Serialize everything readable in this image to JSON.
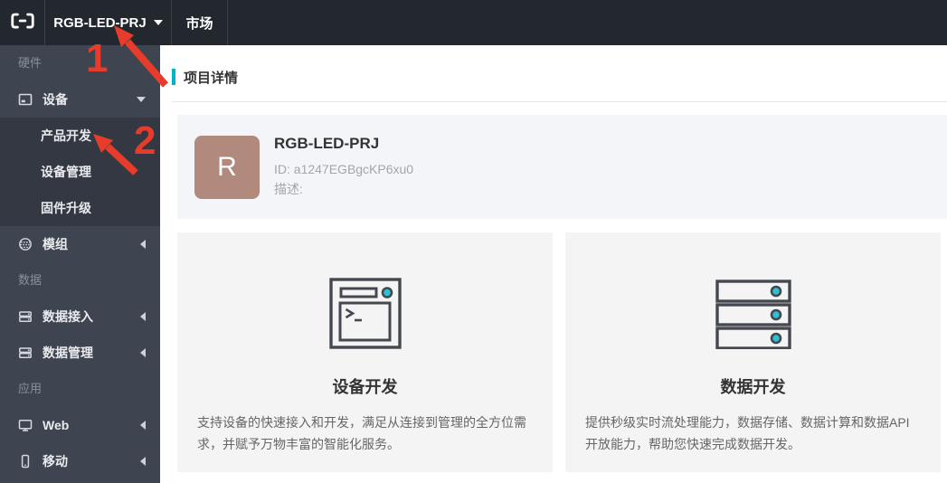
{
  "navbar": {
    "project_dropdown": "RGB-LED-PRJ",
    "market": "市场"
  },
  "sidebar": {
    "section_hardware": "硬件",
    "device": "设备",
    "device_children": [
      "产品开发",
      "设备管理",
      "固件升级"
    ],
    "module": "模组",
    "section_data": "数据",
    "data_access": "数据接入",
    "data_management": "数据管理",
    "section_app": "应用",
    "web": "Web",
    "mobile": "移动"
  },
  "main": {
    "page_title": "项目详情",
    "project": {
      "avatar_letter": "R",
      "name": "RGB-LED-PRJ",
      "id_line": "ID: a1247EGBgcKP6xu0",
      "desc_label": "描述:"
    },
    "cards": [
      {
        "icon": "terminal-window-icon",
        "title": "设备开发",
        "description": "支持设备的快速接入和开发，满足从连接到管理的全方位需求，并赋予万物丰富的智能化服务。"
      },
      {
        "icon": "server-stack-icon",
        "title": "数据开发",
        "description": "提供秒级实时流处理能力，数据存储、数据计算和数据API开放能力，帮助您快速完成数据开发。"
      }
    ]
  },
  "annotations": {
    "step1": "1",
    "step2": "2"
  },
  "colors": {
    "navbar_bg": "#23272e",
    "sidebar_bg": "#3e4450",
    "submenu_bg": "#333842",
    "accent_cyan": "#00b4c6",
    "icon_dot_cyan": "#2ec0d4",
    "annotation_red": "#e73b2c",
    "avatar_bg": "#b28a7d",
    "card_bg": "#f4f4f5"
  }
}
